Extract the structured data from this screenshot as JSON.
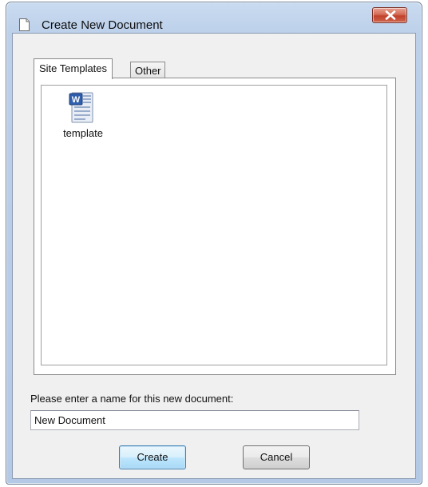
{
  "window": {
    "title": "Create New Document",
    "title_icon": "document-icon",
    "close_icon": "close-icon",
    "close_color": "#c7432d"
  },
  "tabs": [
    {
      "label": "Site Templates",
      "active": true
    },
    {
      "label": "Other",
      "active": false
    }
  ],
  "templates": [
    {
      "label": "template",
      "icon": "word-document-icon"
    }
  ],
  "form": {
    "prompt": "Please enter a name for this new document:",
    "name_value": "New Document"
  },
  "buttons": {
    "create_label": "Create",
    "cancel_label": "Cancel"
  }
}
